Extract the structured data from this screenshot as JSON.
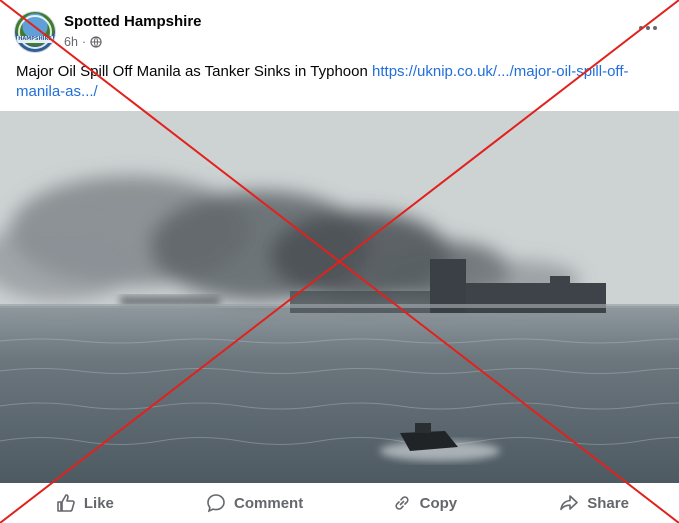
{
  "post": {
    "page_name": "Spotted Hampshire",
    "avatar_text": "HAMPSHIRE",
    "time": "6h",
    "separator": "·",
    "audience_icon": "globe-icon",
    "text": "Major Oil Spill Off Manila as Tanker Sinks in Typhoon ",
    "link_text": "https://uknip.co.uk/.../major-oil-spill-off-manila-as.../",
    "more_icon": "more-options-icon"
  },
  "overlay": {
    "type": "red-cross",
    "color": "#e2211c"
  },
  "actions": [
    {
      "label": "Like",
      "icon": "like-icon"
    },
    {
      "label": "Comment",
      "icon": "comment-icon"
    },
    {
      "label": "Copy",
      "icon": "link-icon"
    },
    {
      "label": "Share",
      "icon": "share-icon"
    }
  ],
  "colors": {
    "link": "#216fdb",
    "secondary_text": "#65676b",
    "primary_text": "#050505"
  }
}
